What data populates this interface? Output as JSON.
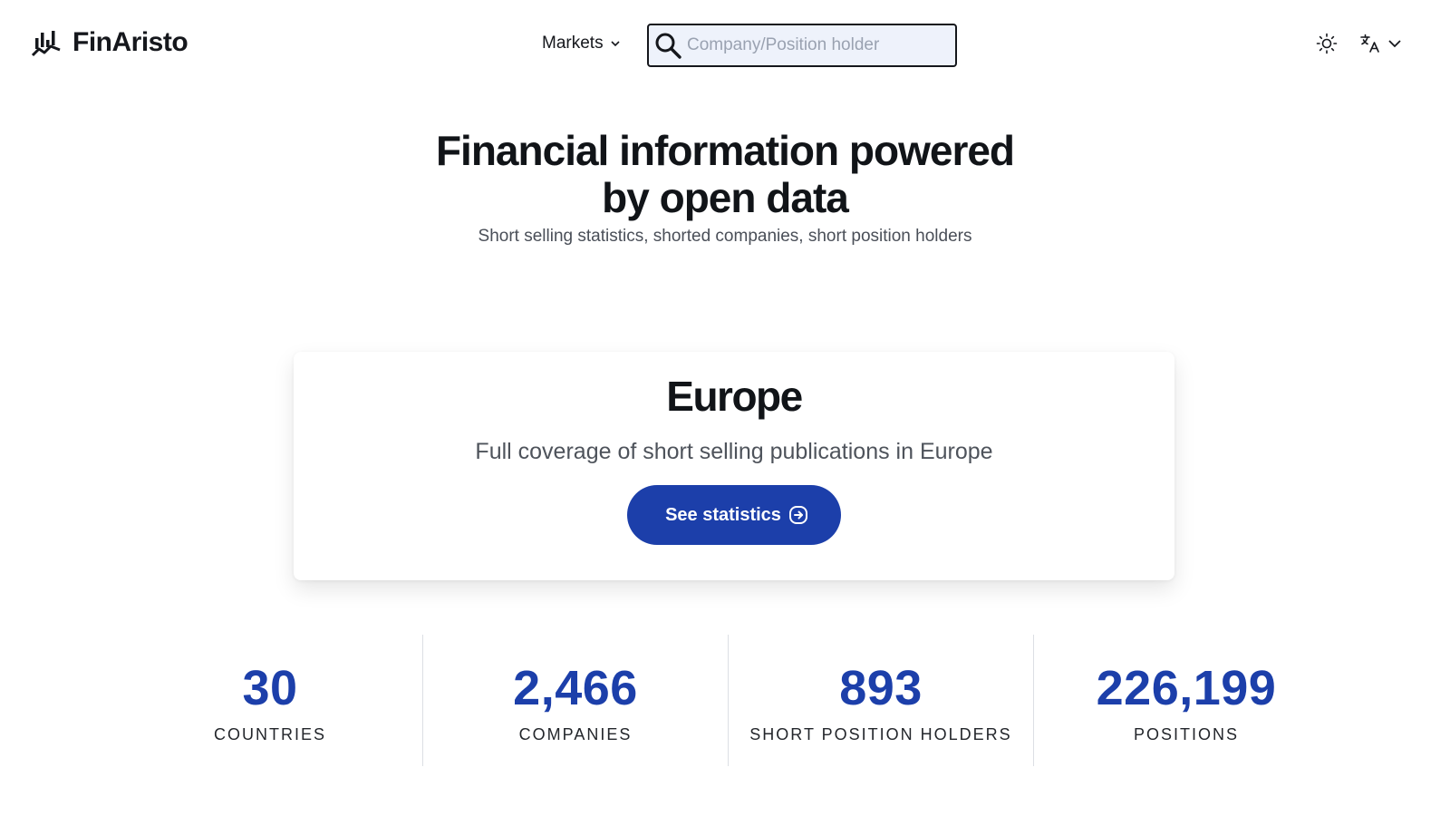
{
  "brand": {
    "name": "FinAristo",
    "logo_icon": "chart-bars-icon"
  },
  "nav": {
    "markets_label": "Markets",
    "search_placeholder": "Company/Position holder",
    "search_value": "",
    "theme_icon": "sun-icon",
    "language_icon": "translate-icon"
  },
  "hero": {
    "title": "Financial information powered by open data",
    "subtitle": "Short selling statistics, shorted companies, short position holders"
  },
  "card": {
    "title": "Europe",
    "text": "Full coverage of short selling publications in Europe",
    "button_label": "See statistics",
    "button_icon": "arrow-right-circle-icon"
  },
  "stats": [
    {
      "value": "30",
      "label": "COUNTRIES"
    },
    {
      "value": "2,466",
      "label": "COMPANIES"
    },
    {
      "value": "893",
      "label": "SHORT POSITION HOLDERS"
    },
    {
      "value": "226,199",
      "label": "POSITIONS"
    }
  ],
  "colors": {
    "accent": "#1c3faa",
    "text": "#111418",
    "search_bg": "#eef2fb"
  }
}
